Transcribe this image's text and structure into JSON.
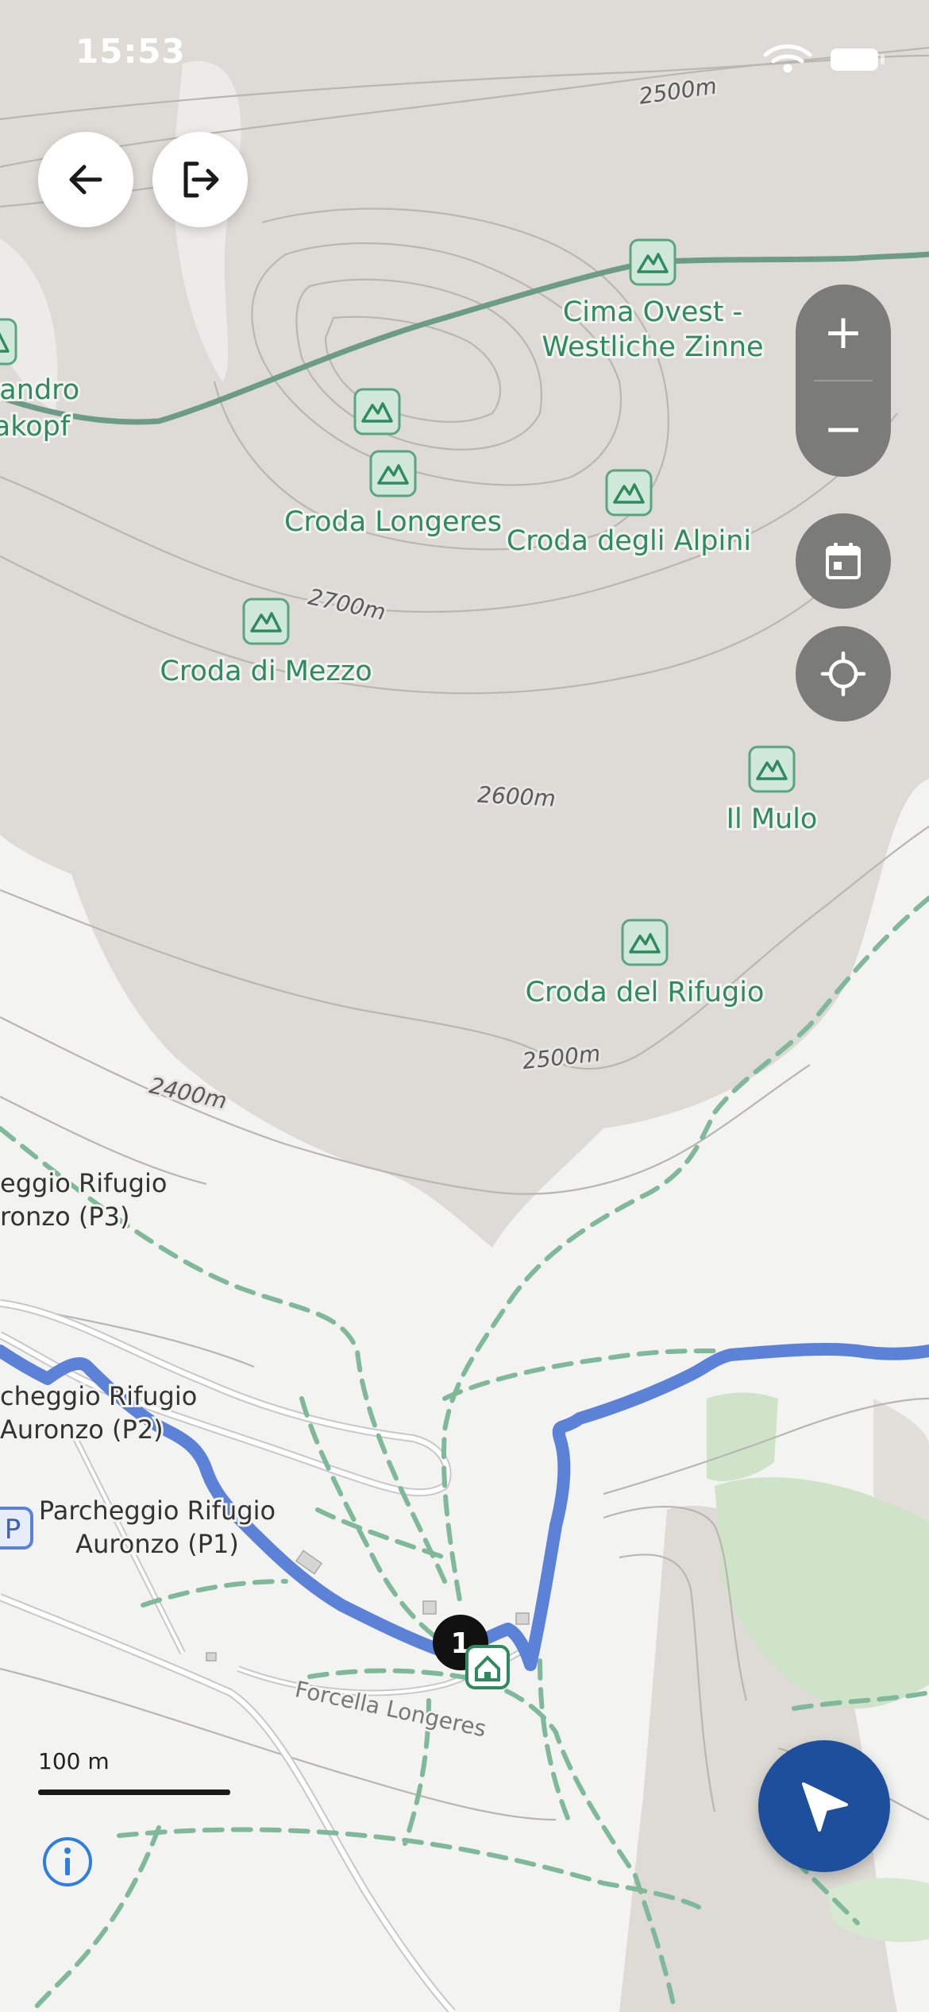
{
  "status_bar": {
    "time": "15:53",
    "wifi_icon": "wifi-icon",
    "battery_icon": "battery-icon"
  },
  "controls": {
    "back_icon": "arrow-left-icon",
    "exit_icon": "logout-icon",
    "zoom_in_label": "+",
    "zoom_out_label": "−",
    "calendar_icon": "calendar-icon",
    "locate_icon": "crosshair-icon",
    "navigate_icon": "navigation-arrow-icon",
    "info_icon": "info-icon"
  },
  "map": {
    "contours": [
      "2500m",
      "2700m",
      "2600m",
      "2500m",
      "2400m"
    ],
    "peaks": [
      "Cima Ovest -",
      "Westliche Zinne",
      "Croda Longeres",
      "Croda degli Alpini",
      "Croda di Mezzo",
      "Il Mulo",
      "Croda del Rifugio",
      "Landro",
      "akopf"
    ],
    "parking": [
      {
        "line1": "eggio Rifugio",
        "line2": "ronzo (P3)"
      },
      {
        "line1": "cheggio Rifugio",
        "line2": "Auronzo (P2)"
      },
      {
        "line1": "Parcheggio Rifugio",
        "line2": "Auronzo (P1)"
      }
    ],
    "parking_sign": "P",
    "road_name": "Forcella Longeres",
    "waypoint_number": "1",
    "hut_icon": "hut-icon",
    "peak_icon": "mountain-icon",
    "colors": {
      "route": "#5b82d6",
      "trail": "#7fb99a",
      "rock": "#dedbd6",
      "forest": "#cfe3c9",
      "ridge": "#6d9c86"
    }
  },
  "scale": {
    "label": "100 m"
  }
}
